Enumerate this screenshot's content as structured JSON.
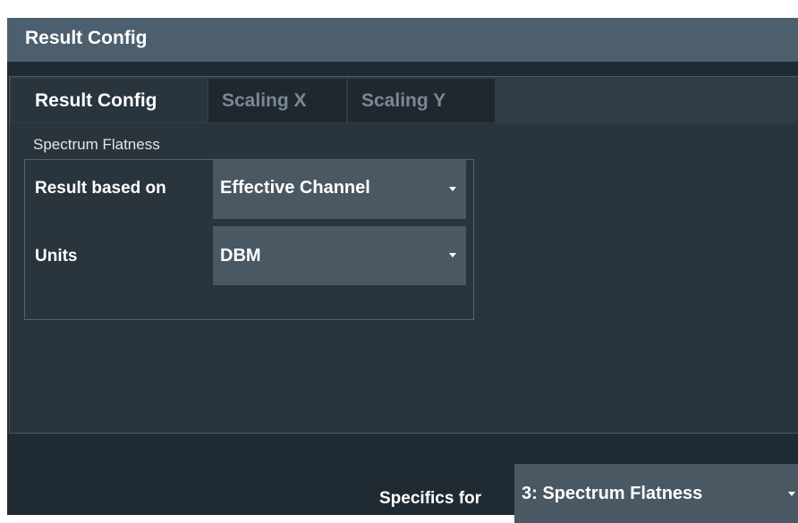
{
  "window": {
    "title": "Result Config"
  },
  "tabs": [
    {
      "label": "Result Config",
      "active": true
    },
    {
      "label": "Scaling X",
      "active": false
    },
    {
      "label": "Scaling Y",
      "active": false
    }
  ],
  "group": {
    "title": "Spectrum Flatness",
    "rows": [
      {
        "label": "Result based on",
        "value": "Effective Channel"
      },
      {
        "label": "Units",
        "value": "DBM"
      }
    ]
  },
  "footer": {
    "label": "Specifics for",
    "value": "3: Spectrum Flatness"
  },
  "colors": {
    "titlebar": "#4d5f6c",
    "background": "#202a32",
    "panel": "#2a343d",
    "dropdown": "#4a5863",
    "inactive_tab_text": "#7b8894"
  },
  "icons": {
    "dropdown": "chevron-down-icon"
  }
}
